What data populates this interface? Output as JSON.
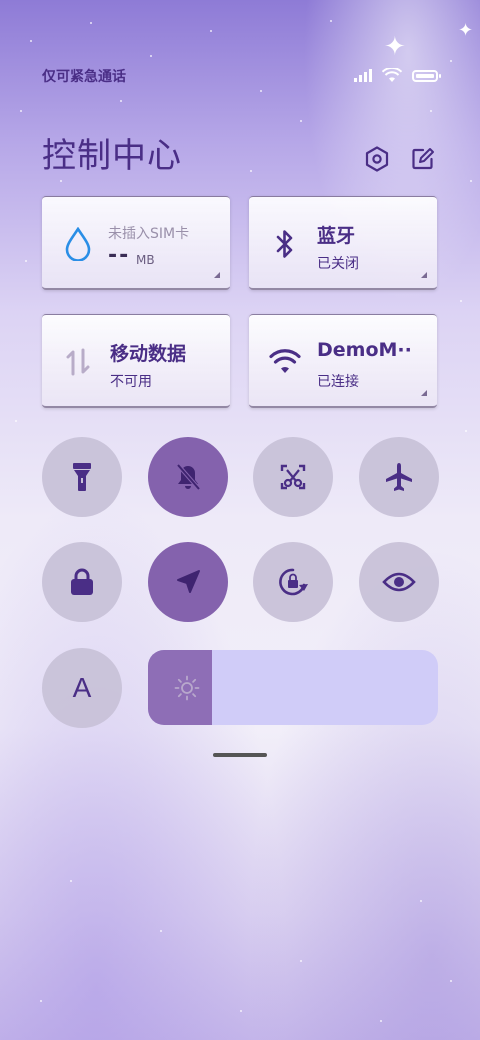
{
  "status_bar": {
    "text": "仅可紧急通话",
    "icons": [
      "signal-icon",
      "wifi-icon",
      "battery-icon"
    ]
  },
  "header": {
    "title": "控制中心",
    "settings_icon": "hexagon-settings-icon",
    "edit_icon": "edit-icon"
  },
  "tiles": [
    {
      "id": "data-usage",
      "icon": "water-drop-icon",
      "label": "未插入SIM卡",
      "value": "--",
      "unit": "MB"
    },
    {
      "id": "bluetooth",
      "icon": "bluetooth-icon",
      "name": "蓝牙",
      "status": "已关闭"
    },
    {
      "id": "mobile-data",
      "icon": "mobile-data-icon",
      "name": "移动数据",
      "status": "不可用"
    },
    {
      "id": "wifi",
      "icon": "wifi-icon",
      "name": "DemoM··",
      "status": "已连接"
    }
  ],
  "toggles": [
    {
      "id": "flashlight",
      "icon": "flashlight-icon",
      "active": false
    },
    {
      "id": "mute",
      "icon": "bell-off-icon",
      "active": true
    },
    {
      "id": "screenshot",
      "icon": "scissors-screenshot-icon",
      "active": false
    },
    {
      "id": "airplane",
      "icon": "airplane-icon",
      "active": false
    },
    {
      "id": "lock",
      "icon": "lock-icon",
      "active": false
    },
    {
      "id": "location",
      "icon": "location-arrow-icon",
      "active": true
    },
    {
      "id": "rotation-lock",
      "icon": "rotation-lock-icon",
      "active": false
    },
    {
      "id": "eye-comfort",
      "icon": "eye-icon",
      "active": false
    },
    {
      "id": "font-size",
      "icon": "font-a-icon",
      "label": "A",
      "active": false
    }
  ],
  "brightness": {
    "icon": "sun-icon",
    "level": 0.22
  },
  "colors": {
    "accent": "#4a2e86",
    "active_toggle": "#8462ad",
    "inactive_toggle": "#c8c2d8",
    "brightness_track": "#d0ccf8",
    "brightness_fill": "#8e6eb6",
    "water_drop": "#2a8ee6"
  }
}
